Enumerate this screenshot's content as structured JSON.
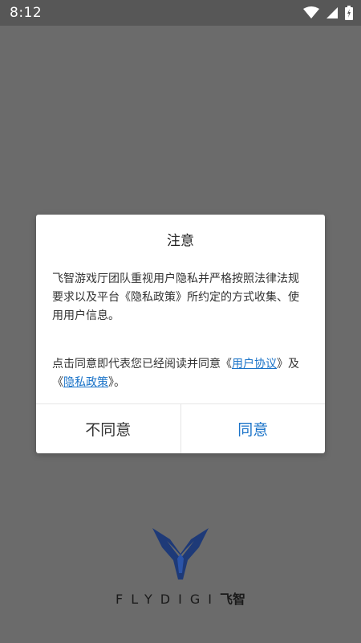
{
  "status_bar": {
    "time": "8:12",
    "icons": [
      "wifi-icon",
      "cell-signal-icon",
      "battery-icon"
    ]
  },
  "dialog": {
    "title": "注意",
    "paragraph1": "飞智游戏厅团队重视用户隐私并严格按照法律法规要求以及平台《隐私政策》所约定的方式收集、使用用户信息。",
    "paragraph2_prefix": "点击同意即代表您已经阅读并同意《",
    "user_agreement_link": "用户协议",
    "paragraph2_mid": "》及《",
    "privacy_policy_link": "隐私政策",
    "paragraph2_suffix": "》。",
    "disagree_label": "不同意",
    "agree_label": "同意"
  },
  "brand": {
    "latin": "FLYDIGI",
    "chinese": "飞智"
  },
  "colors": {
    "accent": "#1a73c8",
    "overlay": "#6b6b6b",
    "status_bar": "#575757",
    "logo": "#1e3a78"
  }
}
